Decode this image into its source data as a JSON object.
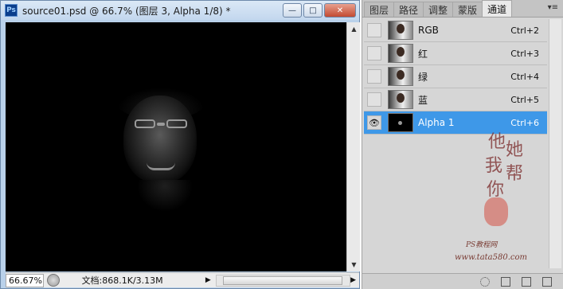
{
  "document": {
    "app_icon": "Ps",
    "title": "source01.psd @ 66.7% (图层 3, Alpha 1/8) *",
    "buttons": {
      "minimize": "—",
      "maximize": "□",
      "close": "✕"
    }
  },
  "status": {
    "zoom": "66.67%",
    "info": "文档:868.1K/3.13M",
    "arrow": "▶",
    "scroll_right": "▶"
  },
  "scrollbar": {
    "up": "▲",
    "down": "▼"
  },
  "panel": {
    "tabs": [
      {
        "label": "图层",
        "active": false
      },
      {
        "label": "路径",
        "active": false
      },
      {
        "label": "调整",
        "active": false
      },
      {
        "label": "蒙版",
        "active": false
      },
      {
        "label": "通道",
        "active": true
      }
    ],
    "menu_icon": "▾≡",
    "channels": [
      {
        "name": "RGB",
        "shortcut": "Ctrl+2",
        "thumb": "photo",
        "visible": false,
        "selected": false
      },
      {
        "name": "红",
        "shortcut": "Ctrl+3",
        "thumb": "photo",
        "visible": false,
        "selected": false
      },
      {
        "name": "绿",
        "shortcut": "Ctrl+4",
        "thumb": "photo",
        "visible": false,
        "selected": false
      },
      {
        "name": "蓝",
        "shortcut": "Ctrl+5",
        "thumb": "photo",
        "visible": false,
        "selected": false
      },
      {
        "name": "Alpha 1",
        "shortcut": "Ctrl+6",
        "thumb": "alpha",
        "visible": true,
        "selected": true
      }
    ],
    "eye_glyph": "👁",
    "watermark": {
      "chars": [
        "他",
        "她",
        "我",
        "帮",
        "你"
      ],
      "site": "PS教程网",
      "url": "www.tata580.com"
    },
    "footer_icons": [
      "load-selection-icon",
      "save-selection-icon",
      "new-channel-icon",
      "delete-channel-icon"
    ]
  },
  "colors": {
    "selected_row": "#3e98e8",
    "panel_bg": "#d6d6d6",
    "canvas": "#000000"
  }
}
